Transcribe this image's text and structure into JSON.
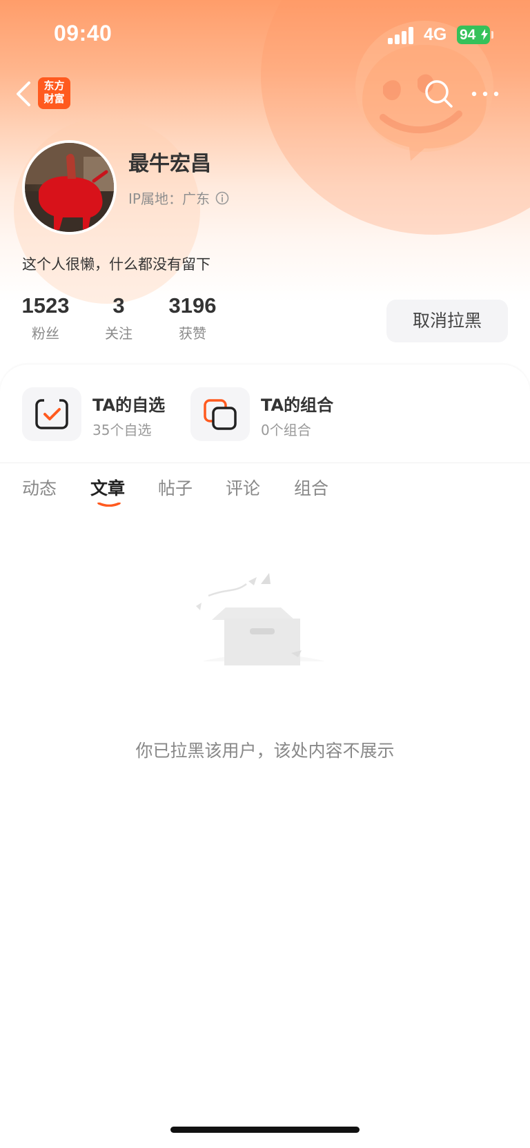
{
  "status_bar": {
    "time": "09:40",
    "network": "4G",
    "battery": "94"
  },
  "nav": {
    "back_icon": "chevron-left-icon",
    "logo_line1": "东方",
    "logo_line2": "财富",
    "search_icon": "search-icon",
    "more_icon": "more-dots-icon"
  },
  "profile": {
    "name": "最牛宏昌",
    "ip_location": "IP属地：广东",
    "bio": "这个人很懒，什么都没有留下",
    "unblock_label": "取消拉黑"
  },
  "stats": [
    {
      "value": "1523",
      "label": "粉丝"
    },
    {
      "value": "3",
      "label": "关注"
    },
    {
      "value": "3196",
      "label": "获赞"
    }
  ],
  "features": [
    {
      "title": "TA的自选",
      "subtitle": "35个自选",
      "icon": "watchlist-check-icon"
    },
    {
      "title": "TA的组合",
      "subtitle": "0个组合",
      "icon": "portfolio-stack-icon"
    }
  ],
  "tabs": [
    {
      "label": "动态",
      "active": false
    },
    {
      "label": "文章",
      "active": true
    },
    {
      "label": "帖子",
      "active": false
    },
    {
      "label": "评论",
      "active": false
    },
    {
      "label": "组合",
      "active": false
    }
  ],
  "empty_state": {
    "message": "你已拉黑该用户，该处内容不展示",
    "icon": "empty-box-icon"
  },
  "colors": {
    "accent": "#ff5a1f",
    "hero_top": "#ff9d6a",
    "battery": "#35c15a"
  }
}
